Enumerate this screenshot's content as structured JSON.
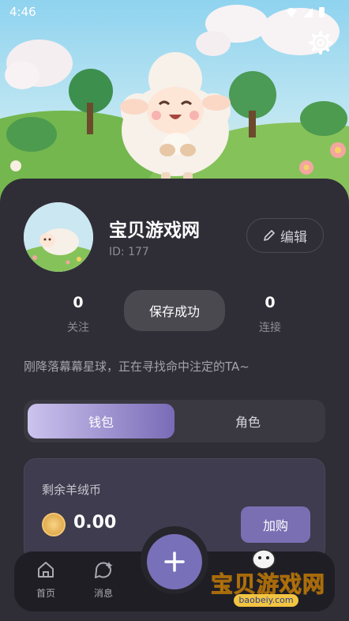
{
  "status": {
    "time": "4:46"
  },
  "profile": {
    "name": "宝贝游戏网",
    "id_text": "ID: 177",
    "edit_label": "编辑"
  },
  "stats": [
    {
      "value": "0",
      "label": "关注"
    },
    {
      "value": "",
      "label": ""
    },
    {
      "value": "0",
      "label": "连接"
    }
  ],
  "toast": "保存成功",
  "bio": "刚降落幕幕星球，正在寻找命中注定的TA~",
  "tabs": {
    "wallet": "钱包",
    "role": "角色"
  },
  "wallet": {
    "title": "剩余羊绒币",
    "balance": "0.00",
    "buy_label": "加购"
  },
  "nav": {
    "home": "首页",
    "messages": "消息"
  },
  "watermark": {
    "text": "宝贝游戏网",
    "url": "baobeiy.com"
  },
  "colors": {
    "background": "#26252c",
    "card": "#2f2e36",
    "accent": "#7870b8"
  },
  "icons": [
    "gear-icon",
    "pencil-icon",
    "coin-icon",
    "home-icon",
    "message-sparkle-icon",
    "plus-icon"
  ]
}
